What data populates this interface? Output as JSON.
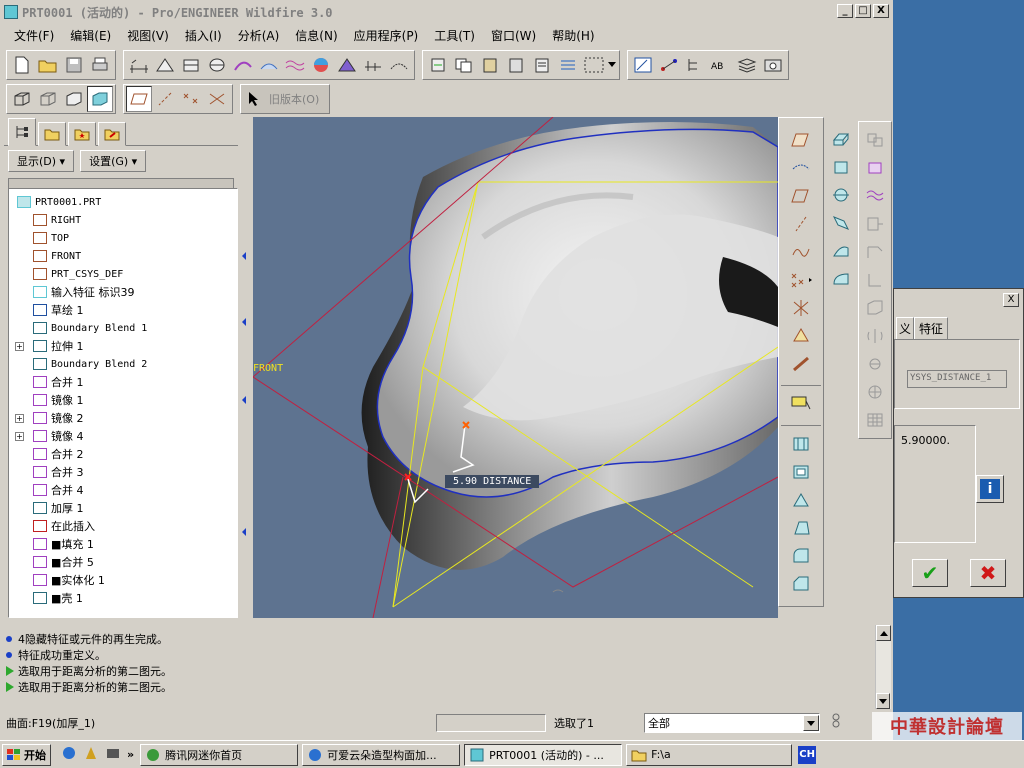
{
  "window": {
    "title": "PRT0001 (活动的) - Pro/ENGINEER Wildfire 3.0",
    "min": "_",
    "max": "□",
    "close": "X"
  },
  "menu": [
    {
      "label": "文件(F)"
    },
    {
      "label": "编辑(E)"
    },
    {
      "label": "视图(V)"
    },
    {
      "label": "插入(I)"
    },
    {
      "label": "分析(A)"
    },
    {
      "label": "信息(N)"
    },
    {
      "label": "应用程序(P)"
    },
    {
      "label": "工具(T)"
    },
    {
      "label": "窗口(W)"
    },
    {
      "label": "帮助(H)"
    }
  ],
  "toolbar2": {
    "old_version": "旧版本(O)"
  },
  "left_panel": {
    "show_label": "显示(D) ▾",
    "settings_label": "设置(G) ▾",
    "tree": [
      {
        "label": "PRT0001.PRT",
        "mono": true,
        "indent": 0,
        "expand": ""
      },
      {
        "label": "RIGHT",
        "mono": true,
        "indent": 1,
        "expand": ""
      },
      {
        "label": "TOP",
        "mono": true,
        "indent": 1,
        "expand": ""
      },
      {
        "label": "FRONT",
        "mono": true,
        "indent": 1,
        "expand": ""
      },
      {
        "label": "PRT_CSYS_DEF",
        "mono": true,
        "indent": 1,
        "expand": ""
      },
      {
        "label": "输入特征 标识39",
        "mono": false,
        "indent": 1,
        "expand": ""
      },
      {
        "label": "草绘 1",
        "mono": false,
        "indent": 1,
        "expand": ""
      },
      {
        "label": "Boundary Blend 1",
        "mono": true,
        "indent": 1,
        "expand": ""
      },
      {
        "label": "拉伸 1",
        "mono": false,
        "indent": 1,
        "expand": "+"
      },
      {
        "label": "Boundary Blend 2",
        "mono": true,
        "indent": 1,
        "expand": ""
      },
      {
        "label": "合并 1",
        "mono": false,
        "indent": 1,
        "expand": ""
      },
      {
        "label": "镜像 1",
        "mono": false,
        "indent": 1,
        "expand": ""
      },
      {
        "label": "镜像 2",
        "mono": false,
        "indent": 1,
        "expand": "+"
      },
      {
        "label": "镜像 4",
        "mono": false,
        "indent": 1,
        "expand": "+"
      },
      {
        "label": "合并 2",
        "mono": false,
        "indent": 1,
        "expand": ""
      },
      {
        "label": "合并 3",
        "mono": false,
        "indent": 1,
        "expand": ""
      },
      {
        "label": "合并 4",
        "mono": false,
        "indent": 1,
        "expand": ""
      },
      {
        "label": "加厚 1",
        "mono": false,
        "indent": 1,
        "expand": ""
      },
      {
        "label": "在此插入",
        "mono": false,
        "indent": 1,
        "expand": ""
      },
      {
        "label": "■填充 1",
        "mono": false,
        "indent": 1,
        "expand": ""
      },
      {
        "label": "■合并 5",
        "mono": false,
        "indent": 1,
        "expand": ""
      },
      {
        "label": "■实体化 1",
        "mono": false,
        "indent": 1,
        "expand": ""
      },
      {
        "label": "■壳 1",
        "mono": false,
        "indent": 1,
        "expand": ""
      }
    ]
  },
  "viewport": {
    "plane_label": "FRONT",
    "measure_label": "5.90  DISTANCE"
  },
  "dialog": {
    "tab1": "义",
    "tab2": "特征",
    "field": "YSYS_DISTANCE_1",
    "value": "5.90000.",
    "info": "i",
    "ok": "✔",
    "cancel": "✖"
  },
  "messages": [
    {
      "type": "bullet",
      "text": "4隐藏特征或元件的再生完成。"
    },
    {
      "type": "bullet",
      "text": "特征成功重定义。"
    },
    {
      "type": "arrow",
      "text": "选取用于距离分析的第二图元。"
    },
    {
      "type": "arrow",
      "text": "选取用于距离分析的第二图元。"
    }
  ],
  "status": {
    "left": "曲面:F19(加厚_1)",
    "selected": "选取了1",
    "filter": "全部"
  },
  "taskbar": {
    "start": "开始",
    "items": [
      {
        "label": "腾讯网迷你首页"
      },
      {
        "label": "可爱云朵造型构面加..."
      },
      {
        "label": "PRT0001 (活动的) - ..."
      },
      {
        "label": "F:\\a"
      }
    ],
    "lang": "CH",
    "watermark": "中華設計論壇"
  }
}
